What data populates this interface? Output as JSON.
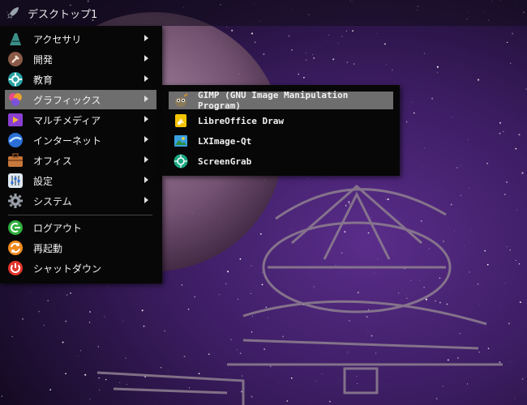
{
  "panel": {
    "title": "デスクトップ1"
  },
  "menu": {
    "items": [
      {
        "label": "アクセサリ",
        "icon": "accessories-icon"
      },
      {
        "label": "開発",
        "icon": "development-icon"
      },
      {
        "label": "教育",
        "icon": "education-icon"
      },
      {
        "label": "グラフィックス",
        "icon": "graphics-icon"
      },
      {
        "label": "マルチメディア",
        "icon": "multimedia-icon"
      },
      {
        "label": "インターネット",
        "icon": "internet-icon"
      },
      {
        "label": "オフィス",
        "icon": "office-icon"
      },
      {
        "label": "設定",
        "icon": "settings-icon"
      },
      {
        "label": "システム",
        "icon": "system-icon"
      }
    ],
    "actions": [
      {
        "label": "ログアウト",
        "icon": "logout-icon"
      },
      {
        "label": "再起動",
        "icon": "reboot-icon"
      },
      {
        "label": "シャットダウン",
        "icon": "shutdown-icon"
      }
    ]
  },
  "submenu": {
    "items": [
      {
        "label": "GIMP (GNU Image Manipulation Program)",
        "icon": "gimp-icon"
      },
      {
        "label": "LibreOffice Draw",
        "icon": "libreoffice-draw-icon"
      },
      {
        "label": "LXImage-Qt",
        "icon": "lximage-icon"
      },
      {
        "label": "ScreenGrab",
        "icon": "screengrab-icon"
      }
    ]
  }
}
